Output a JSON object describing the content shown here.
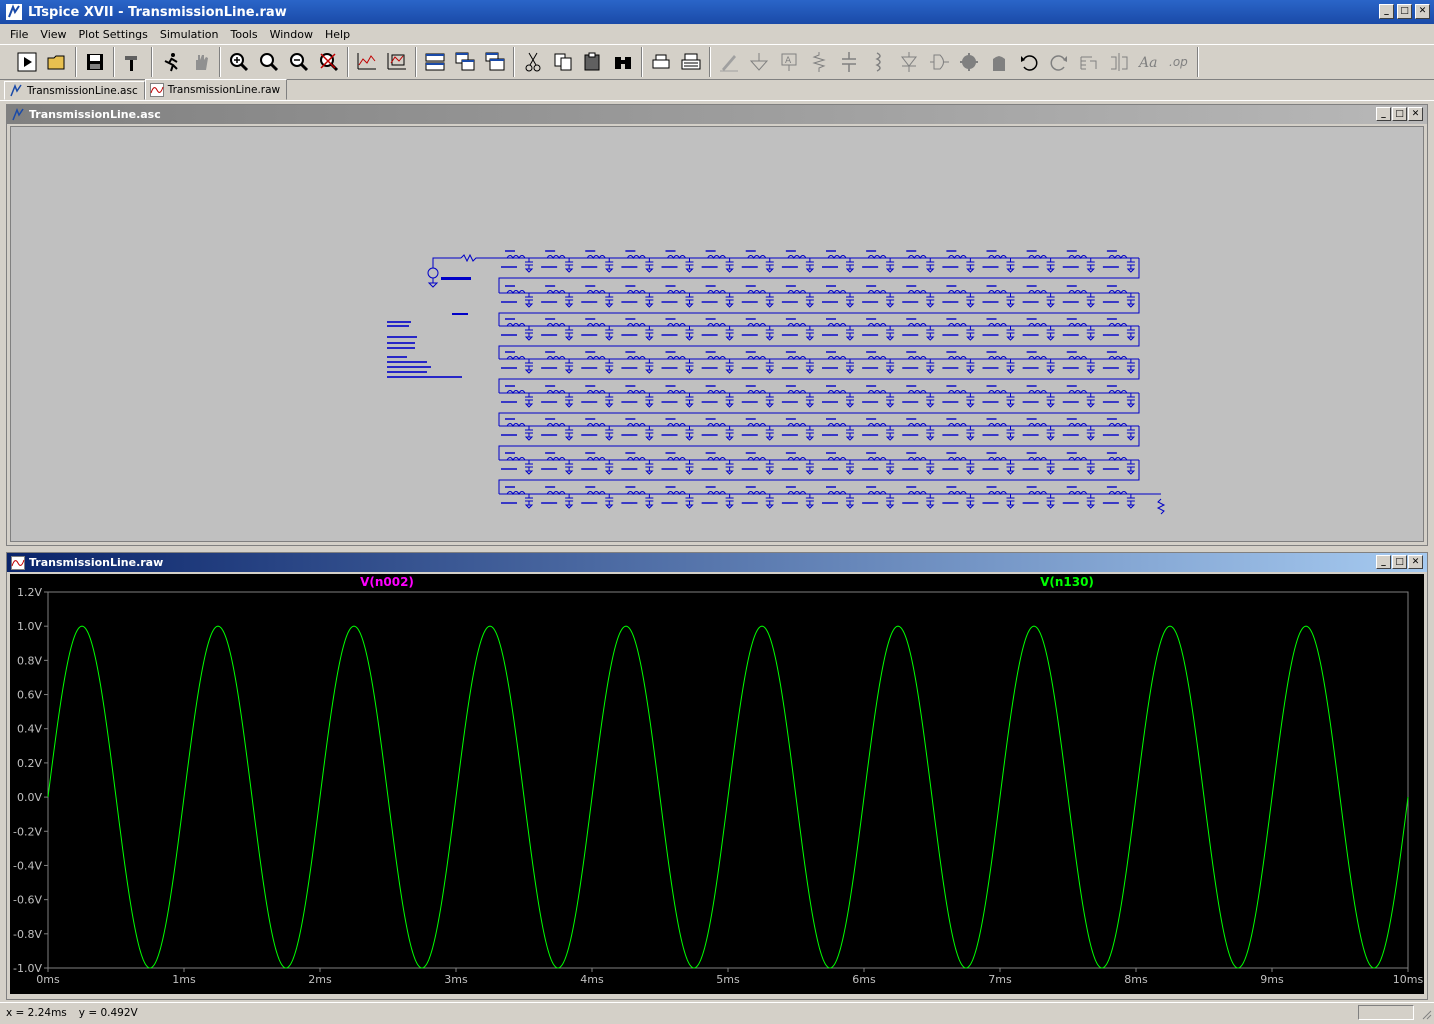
{
  "window": {
    "title": "LTspice XVII - TransmissionLine.raw"
  },
  "menu": [
    "File",
    "View",
    "Plot Settings",
    "Simulation",
    "Tools",
    "Window",
    "Help"
  ],
  "tabs": [
    {
      "label": "TransmissionLine.asc",
      "icon": "schematic-icon"
    },
    {
      "label": "TransmissionLine.raw",
      "icon": "waveform-icon"
    }
  ],
  "schematic_window": {
    "title": "TransmissionLine.asc"
  },
  "plot_window": {
    "title": "TransmissionLine.raw"
  },
  "plot": {
    "traces": [
      {
        "name": "V(n002)",
        "color": "#ff00ff"
      },
      {
        "name": "V(n130)",
        "color": "#00ff00"
      }
    ],
    "y_ticks": [
      "1.2V",
      "1.0V",
      "0.8V",
      "0.6V",
      "0.4V",
      "0.2V",
      "0.0V",
      "-0.2V",
      "-0.4V",
      "-0.6V",
      "-0.8V",
      "-1.0V"
    ],
    "x_ticks": [
      "0ms",
      "1ms",
      "2ms",
      "3ms",
      "4ms",
      "5ms",
      "6ms",
      "7ms",
      "8ms",
      "9ms",
      "10ms"
    ]
  },
  "chart_data": {
    "type": "line",
    "x_range_ms": [
      0,
      10
    ],
    "ylim": [
      -1.0,
      1.2
    ],
    "series": [
      {
        "name": "V(n130)",
        "color": "#00ff00",
        "function": "sine",
        "amplitude": 1.0,
        "frequency_hz": 1000,
        "phase_ms": 0.0
      }
    ]
  },
  "status": {
    "x_readout": "x = 2.24ms",
    "y_readout": "y = 0.492V"
  }
}
